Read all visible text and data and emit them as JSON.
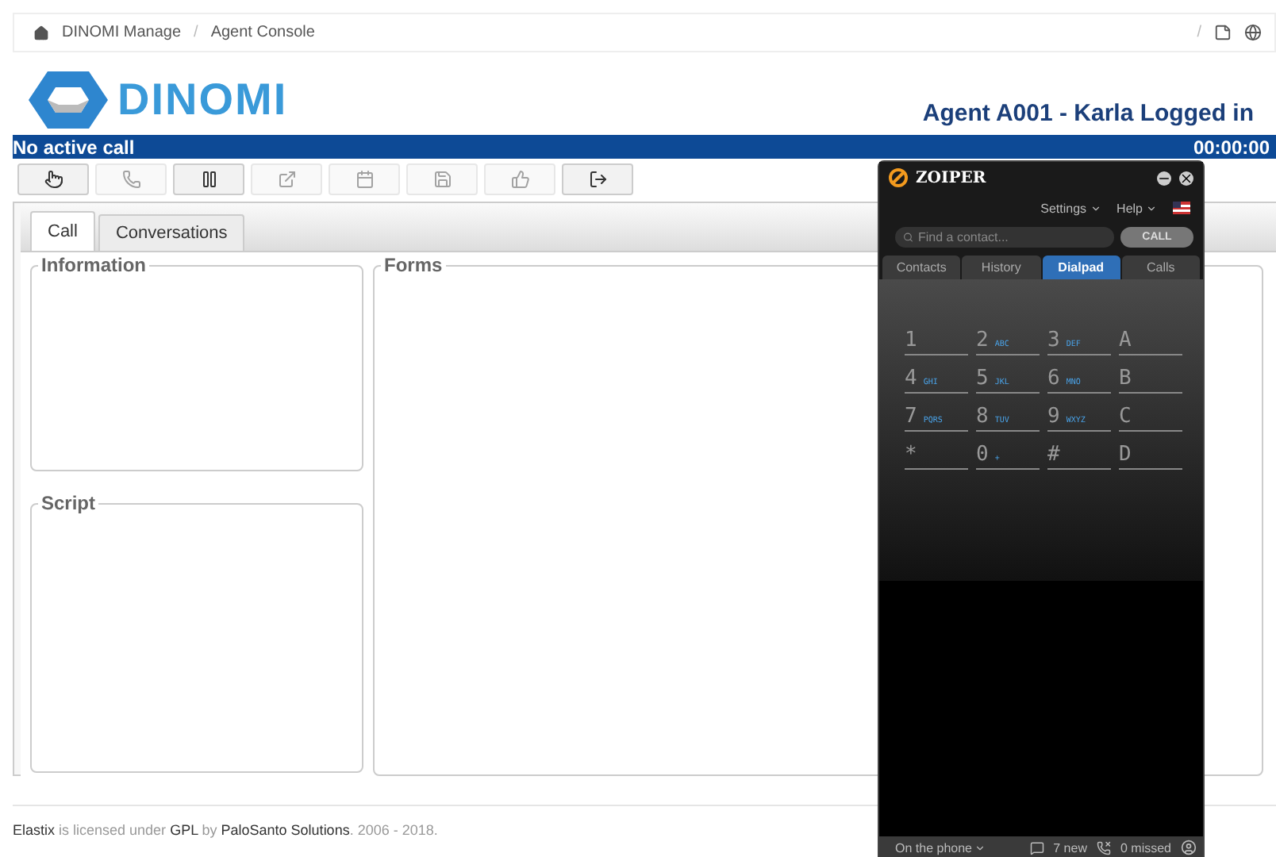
{
  "breadcrumb": [
    "DINOMI Manage",
    "/",
    "Agent Console"
  ],
  "breadcrumb_right_separator": "/",
  "logo": "DINOMI",
  "agent_status": "Agent A001 - Karla Logged in",
  "call_bar": {
    "status": "No active call",
    "timer": "00:00:00"
  },
  "toolbar": [
    {
      "kind": "hand",
      "disabled": false
    },
    {
      "kind": "phone",
      "disabled": true
    },
    {
      "kind": "pause",
      "disabled": false
    },
    {
      "kind": "external",
      "disabled": true
    },
    {
      "kind": "calendar",
      "disabled": true
    },
    {
      "kind": "save",
      "disabled": true
    },
    {
      "kind": "thumb",
      "disabled": true
    },
    {
      "kind": "logout",
      "disabled": false
    }
  ],
  "tabs": [
    {
      "label": "Call",
      "selected": true
    },
    {
      "label": "Conversations",
      "selected": false
    }
  ],
  "panels": {
    "information": "Information",
    "script": "Script",
    "forms": "Forms"
  },
  "footer": [
    {
      "text": "Elastix",
      "link": true
    },
    {
      "text": " is licensed under ",
      "link": false
    },
    {
      "text": "GPL",
      "link": true
    },
    {
      "text": " by ",
      "link": false
    },
    {
      "text": "PaloSanto Solutions",
      "link": true
    },
    {
      "text": ". 2006 - 2018.",
      "link": false
    }
  ],
  "zoiper": {
    "title": "ZOIPER",
    "menu": [
      "Settings",
      "Help"
    ],
    "search": {
      "placeholder": "Find a contact..."
    },
    "call_button": "CALL",
    "tabs": [
      {
        "label": "Contacts",
        "selected": false
      },
      {
        "label": "History",
        "selected": false
      },
      {
        "label": "Dialpad",
        "selected": true
      },
      {
        "label": "Calls",
        "selected": false
      }
    ],
    "keys": [
      {
        "digit": "1"
      },
      {
        "digit": "2",
        "letters": "ABC"
      },
      {
        "digit": "3",
        "letters": "DEF"
      },
      {
        "digit": "A"
      },
      {
        "digit": "4",
        "letters": "GHI"
      },
      {
        "digit": "5",
        "letters": "JKL"
      },
      {
        "digit": "6",
        "letters": "MNO"
      },
      {
        "digit": "B"
      },
      {
        "digit": "7",
        "letters": "PQRS"
      },
      {
        "digit": "8",
        "letters": "TUV"
      },
      {
        "digit": "9",
        "letters": "WXYZ"
      },
      {
        "digit": "C"
      },
      {
        "digit": "*"
      },
      {
        "digit": "0",
        "letters": "+"
      },
      {
        "digit": "#"
      },
      {
        "digit": "D"
      }
    ],
    "status": "On the phone",
    "new_count": "7 new",
    "missed_count": "0 missed"
  }
}
